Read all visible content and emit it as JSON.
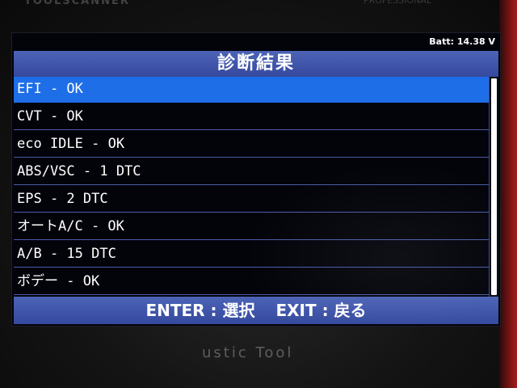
{
  "device": {
    "brand_top_text": "TOOLSCANNER",
    "brand_top_right_text": "PROFESSIONAL",
    "brand_bottom_text": "ustic Tool"
  },
  "status": {
    "battery": "Batt: 14.38 V"
  },
  "header": {
    "title": "診断結果"
  },
  "results": {
    "selected_index": 0,
    "items": [
      {
        "label": "EFI - OK"
      },
      {
        "label": "CVT - OK"
      },
      {
        "label": "eco IDLE - OK"
      },
      {
        "label": "ABS/VSC - 1 DTC"
      },
      {
        "label": "EPS - 2 DTC"
      },
      {
        "label": "オートA/C - OK"
      },
      {
        "label": "A/B - 15 DTC"
      },
      {
        "label": "ボデー - OK"
      }
    ]
  },
  "footer": {
    "enter_label": "ENTER : 選択",
    "exit_label": "EXIT : 戻る"
  },
  "colors": {
    "highlight": "#1e6ee8",
    "bar": "#4058ae",
    "screen_background": "#03030a",
    "text": "#ffffff"
  }
}
